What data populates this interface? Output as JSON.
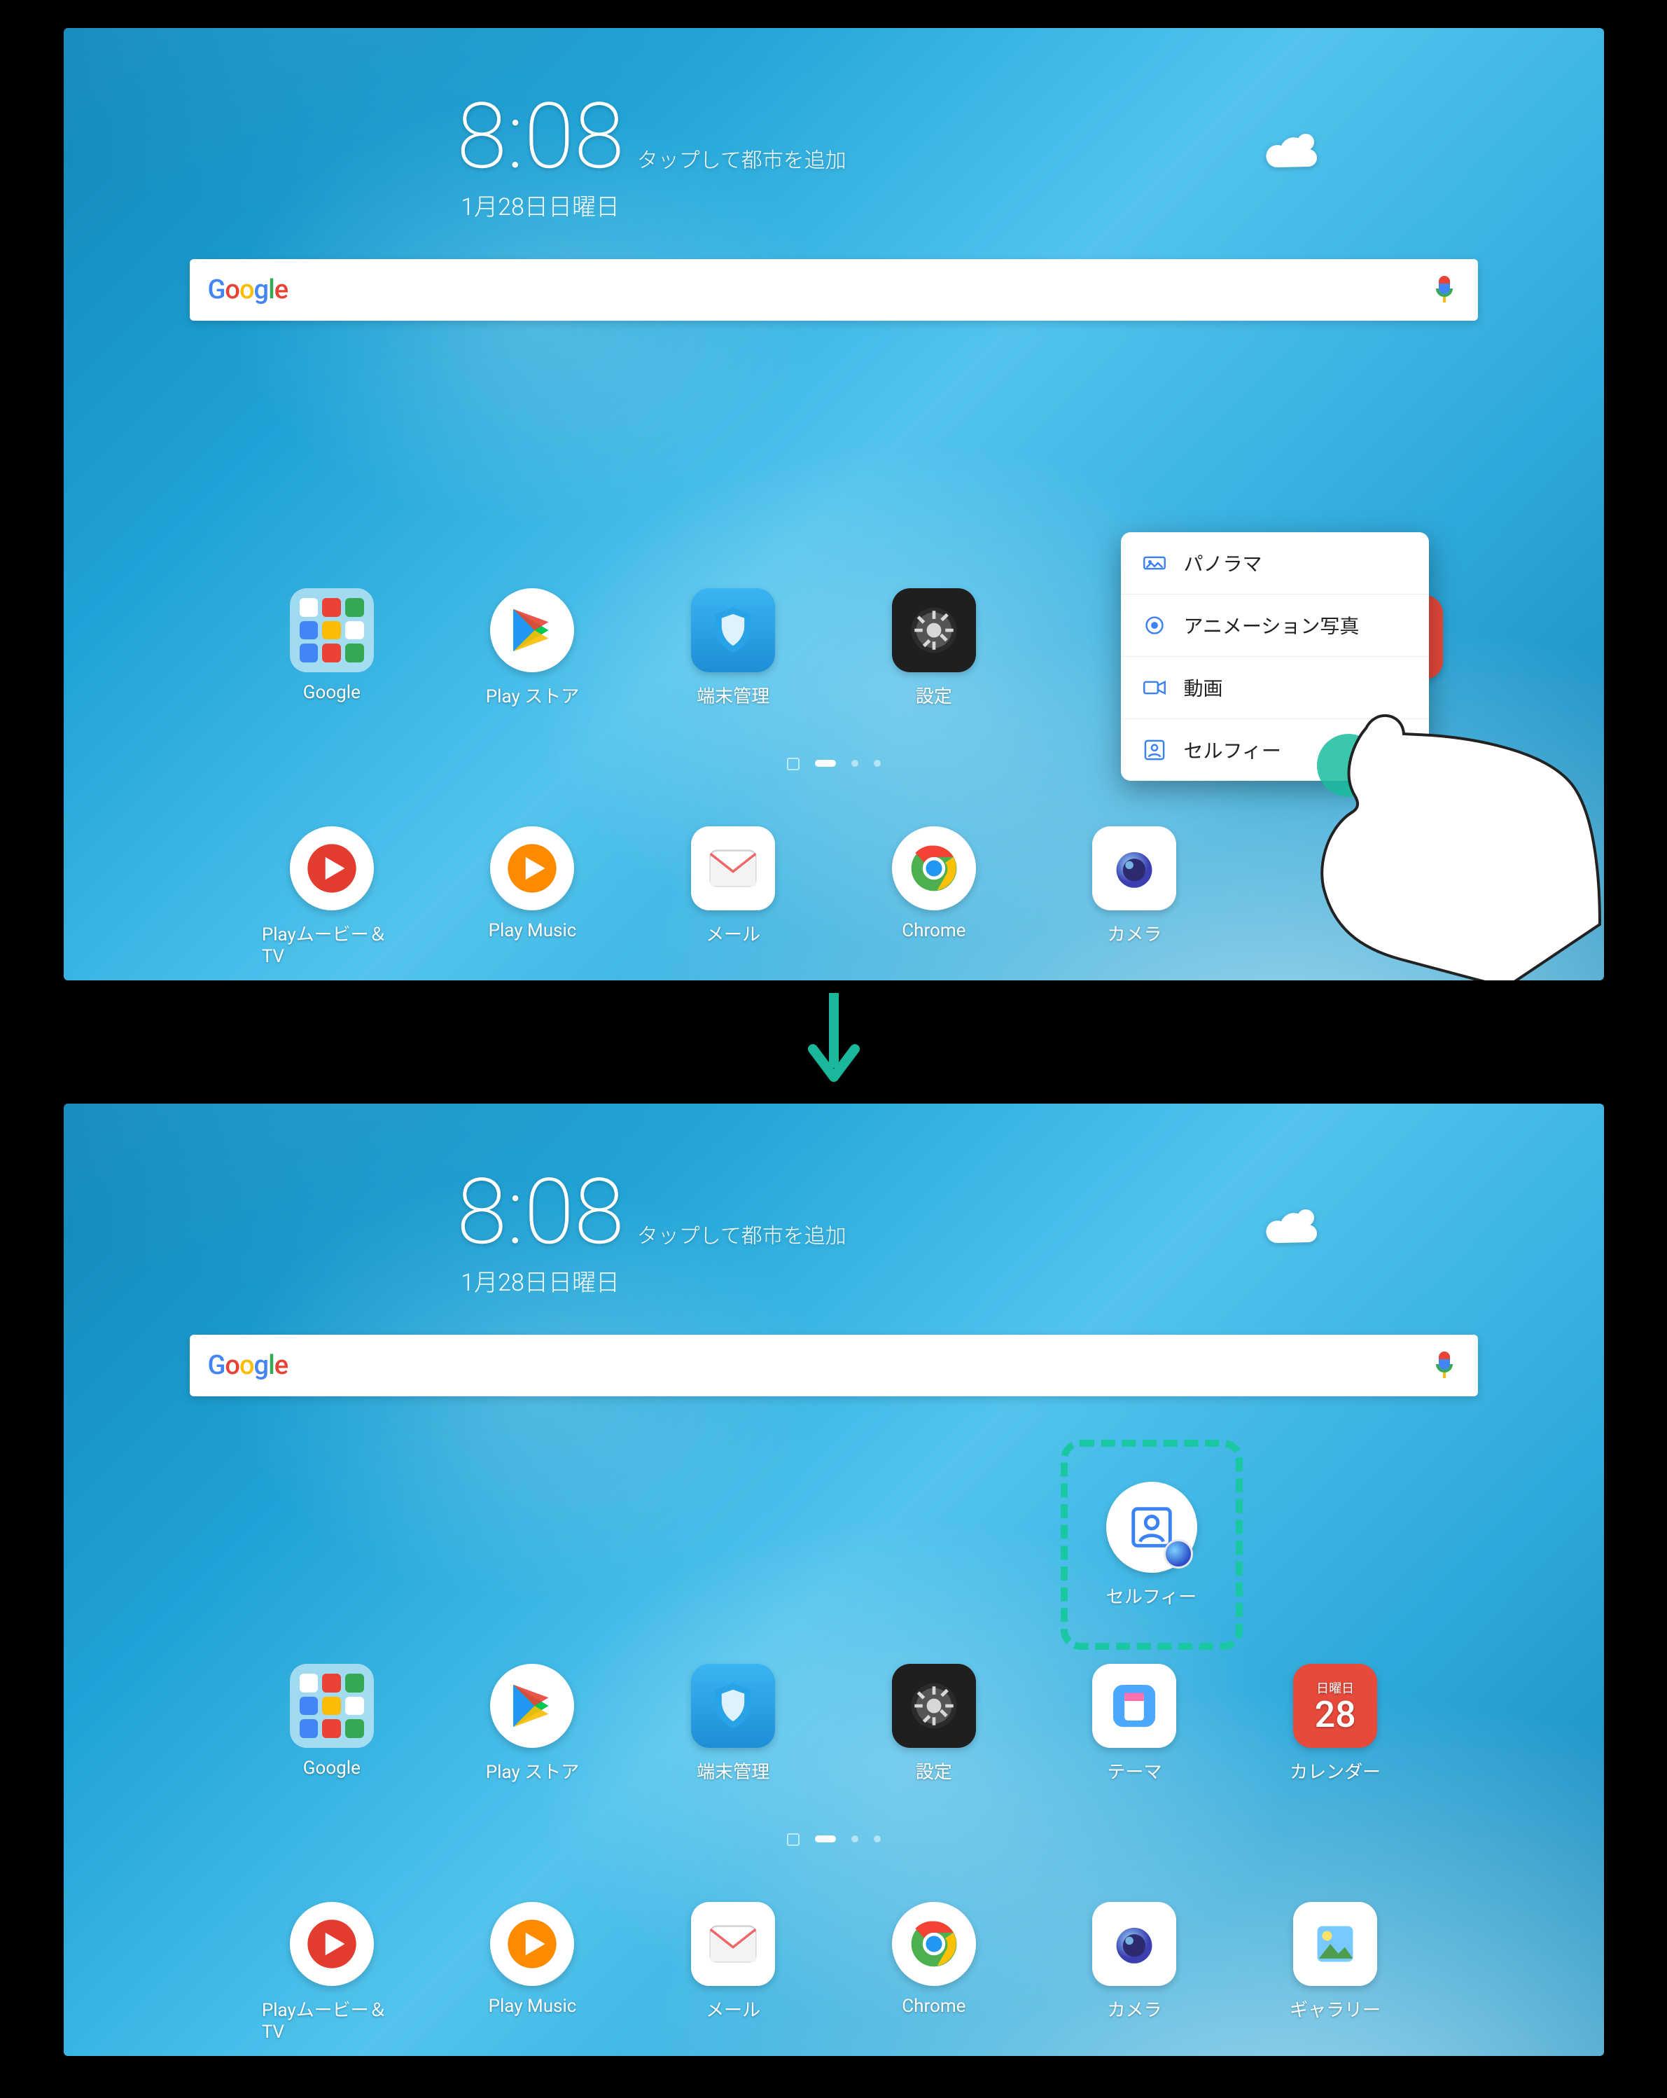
{
  "clock": {
    "time": "8:08",
    "hint": "タップして都市を追加",
    "date": "1月28日日曜日"
  },
  "search": {
    "logo_text": "Google"
  },
  "popup": {
    "items": [
      {
        "key": "panorama",
        "label": "パノラマ"
      },
      {
        "key": "anim-photo",
        "label": "アニメーション写真"
      },
      {
        "key": "video",
        "label": "動画"
      },
      {
        "key": "selfie",
        "label": "セルフィー"
      }
    ]
  },
  "calendar": {
    "dow": "日曜日",
    "day": "28"
  },
  "shortcut": {
    "label": "セルフィー"
  },
  "apps_row1": {
    "s1": [
      {
        "key": "google-folder",
        "label": "Google"
      },
      {
        "key": "play-store",
        "label": "Play ストア"
      },
      {
        "key": "phone-manager",
        "label": "端末管理"
      },
      {
        "key": "settings",
        "label": "設定"
      },
      {
        "key": "",
        "label": ""
      },
      {
        "key": "",
        "label": ""
      }
    ],
    "s2": [
      {
        "key": "google-folder",
        "label": "Google"
      },
      {
        "key": "play-store",
        "label": "Play ストア"
      },
      {
        "key": "phone-manager",
        "label": "端末管理"
      },
      {
        "key": "settings",
        "label": "設定"
      },
      {
        "key": "themes",
        "label": "テーマ"
      },
      {
        "key": "calendar",
        "label": "カレンダー"
      }
    ]
  },
  "apps_row2": {
    "s1": [
      {
        "key": "play-movies",
        "label": "Playムービー＆TV"
      },
      {
        "key": "play-music",
        "label": "Play Music"
      },
      {
        "key": "mail",
        "label": "メール"
      },
      {
        "key": "chrome",
        "label": "Chrome"
      },
      {
        "key": "camera",
        "label": "カメラ"
      },
      {
        "key": "",
        "label": ""
      }
    ],
    "s2": [
      {
        "key": "play-movies",
        "label": "Playムービー＆TV"
      },
      {
        "key": "play-music",
        "label": "Play Music"
      },
      {
        "key": "mail",
        "label": "メール"
      },
      {
        "key": "chrome",
        "label": "Chrome"
      },
      {
        "key": "camera",
        "label": "カメラ"
      },
      {
        "key": "gallery",
        "label": "ギャラリー"
      }
    ]
  }
}
